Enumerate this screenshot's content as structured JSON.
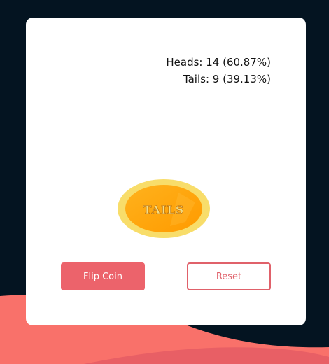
{
  "stats": {
    "heads_label": "Heads: 14 (60.87%)",
    "tails_label": "Tails: 9 (39.13%)"
  },
  "coin": {
    "face": "TAILS"
  },
  "buttons": {
    "flip_label": "Flip Coin",
    "reset_label": "Reset"
  },
  "colors": {
    "background": "#041421",
    "card": "#ffffff",
    "accent": "#ec636b",
    "coin_outer": "#f8dd6a",
    "coin_inner": "#ffa70f"
  }
}
